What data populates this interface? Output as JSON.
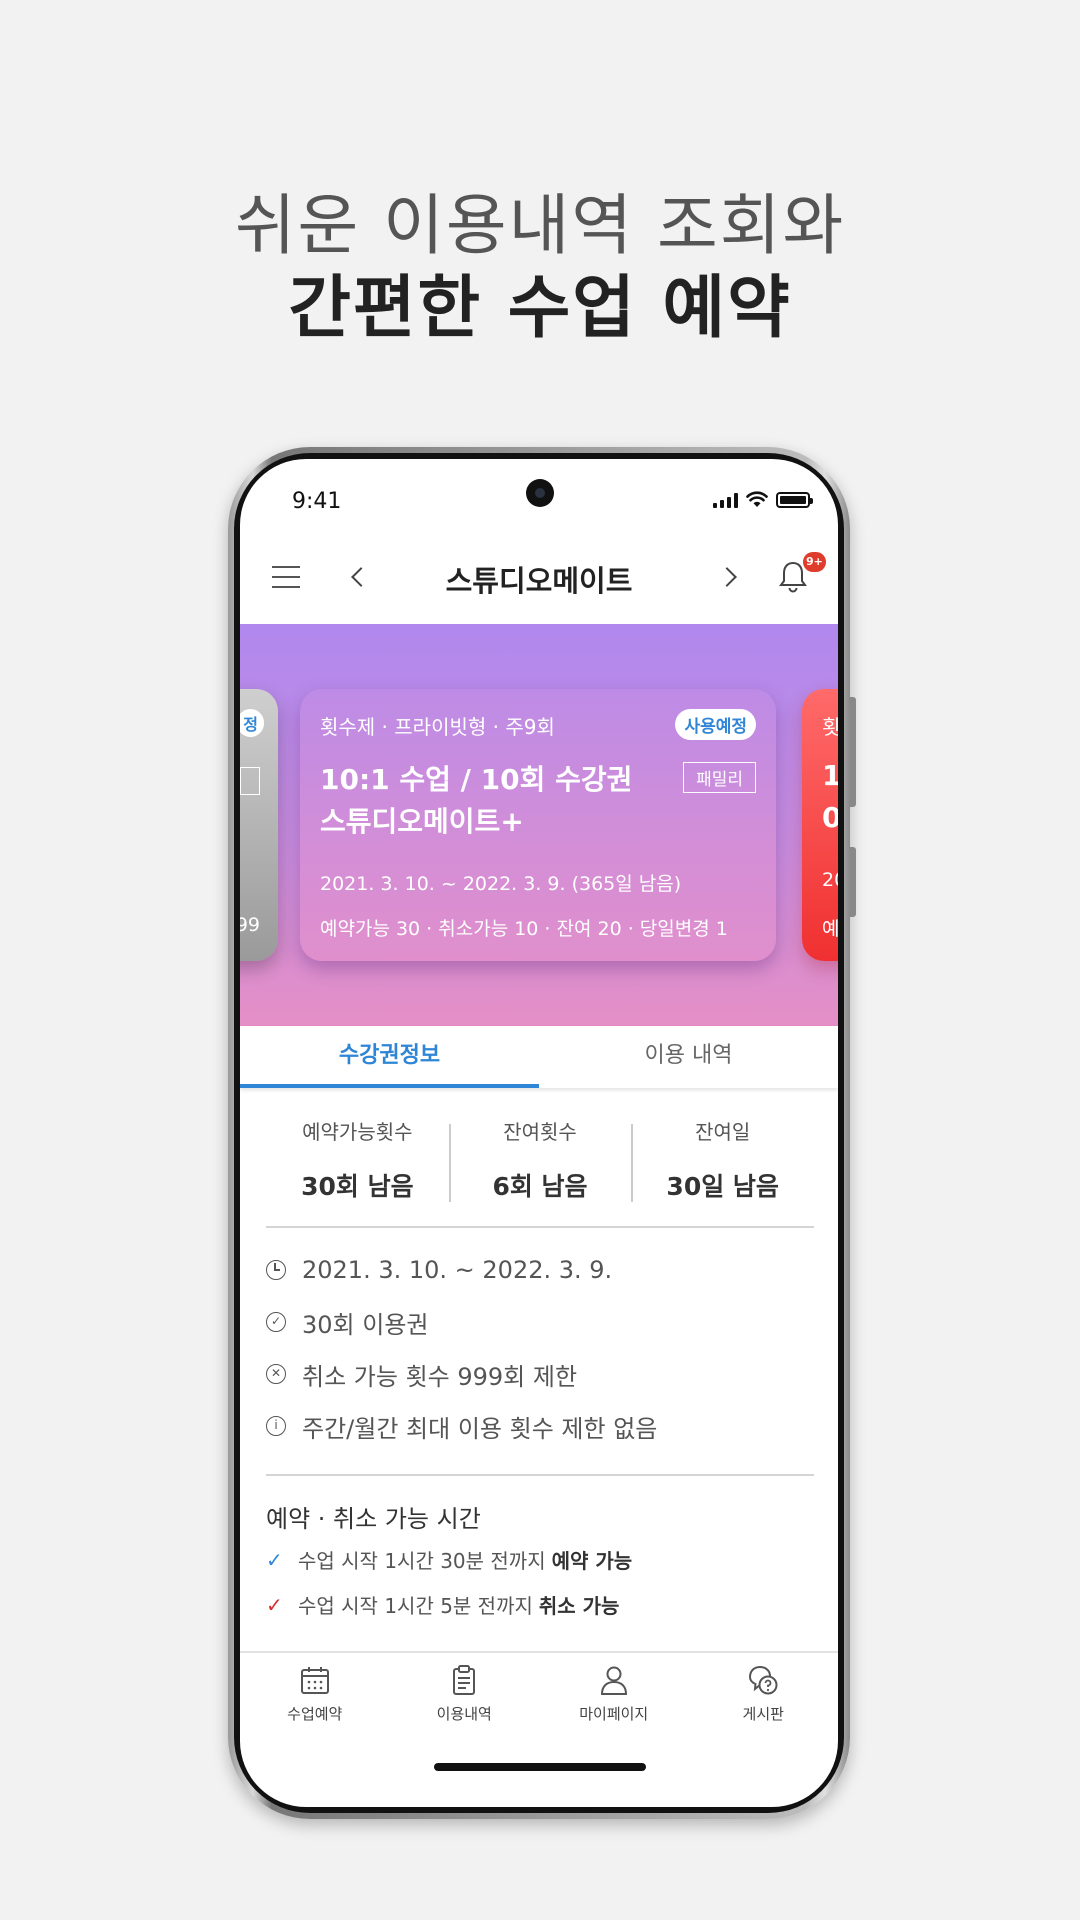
{
  "promo": {
    "line1": "쉬운 이용내역 조회와",
    "line2": "간편한 수업 예약"
  },
  "status_bar": {
    "time": "9:41"
  },
  "header": {
    "title": "스튜디오메이트",
    "notification_badge": "9+"
  },
  "cards": {
    "left_peek": {
      "badge": "정",
      "date": "99"
    },
    "main": {
      "type": "횟수제 · 프라이빗형 · 주9회",
      "status": "사용예정",
      "title_line1": "10:1 수업 / 10회 수강권",
      "title_line2": "스튜디오메이트+",
      "family_tag": "패밀리",
      "period": "2021. 3. 10. ~ 2022. 3. 9.    (365일 남음)",
      "counts": "예약가능 30  · 취소가능 10  · 잔여 20  · 당일변경 1",
      "colors": {
        "top": "#bd8be6",
        "bottom": "#e08fcc"
      }
    },
    "right_peek": {
      "type": "횟",
      "title1": "1",
      "title2": "0",
      "period": "20",
      "counts": "예"
    }
  },
  "tabs": [
    {
      "label": "수강권정보",
      "active": true
    },
    {
      "label": "이용 내역",
      "active": false
    }
  ],
  "stats": [
    {
      "label": "예약가능횟수",
      "value": "30회 남음"
    },
    {
      "label": "잔여횟수",
      "value": "6회 남음"
    },
    {
      "label": "잔여일",
      "value": "30일 남음"
    }
  ],
  "info": [
    {
      "icon": "clock-icon",
      "text": "2021. 3. 10. ~ 2022. 3. 9."
    },
    {
      "icon": "check-circle-icon",
      "text": "30회 이용권"
    },
    {
      "icon": "x-circle-icon",
      "text": "취소 가능 횟수 999회 제한"
    },
    {
      "icon": "info-icon",
      "text": "주간/월간 최대 이용 횟수 제한 없음"
    }
  ],
  "reservation": {
    "title": "예약 · 취소 가능 시간",
    "rules": [
      {
        "text": "수업 시작 1시간 30분 전까지",
        "emphasis": "예약 가능",
        "check_color": "#2f86d6"
      },
      {
        "text": "수업 시작 1시간 5분 전까지",
        "emphasis": "취소 가능",
        "check_color": "#d03030"
      }
    ]
  },
  "bottom_nav": [
    {
      "icon": "calendar-icon",
      "label": "수업예약"
    },
    {
      "icon": "clipboard-icon",
      "label": "이용내역"
    },
    {
      "icon": "person-icon",
      "label": "마이페이지"
    },
    {
      "icon": "chat-question-icon",
      "label": "게시판"
    }
  ],
  "colors": {
    "accent": "#2f86d6",
    "badge": "#e03c2c"
  }
}
